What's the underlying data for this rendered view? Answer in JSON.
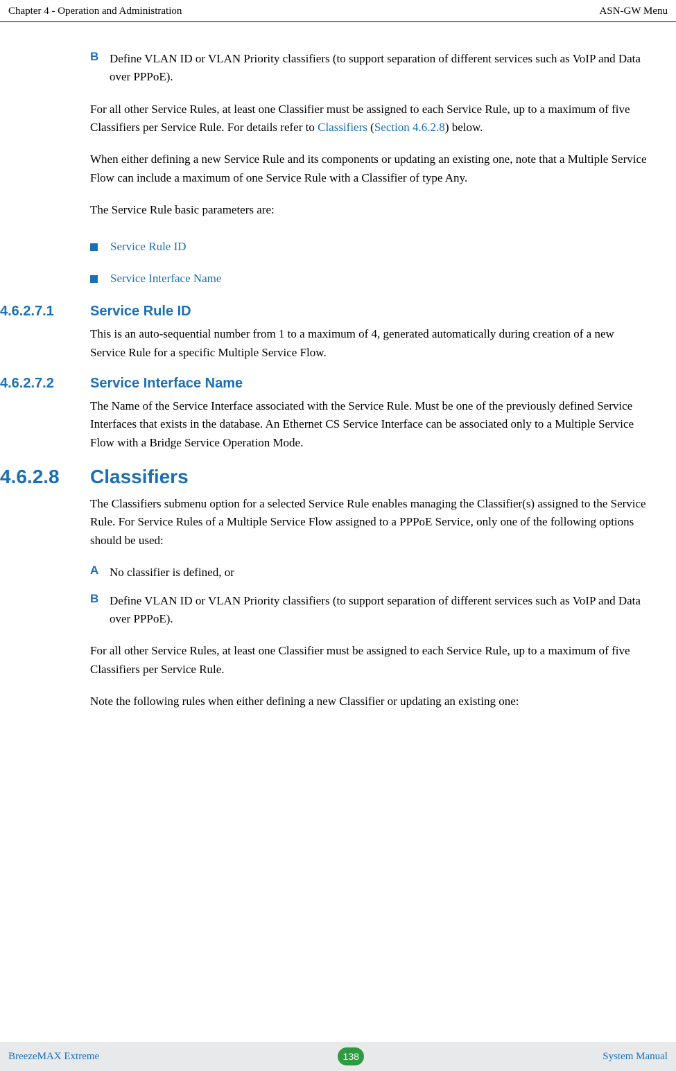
{
  "header": {
    "left": "Chapter 4 - Operation and Administration",
    "right": "ASN-GW Menu"
  },
  "list1": {
    "letter": "B",
    "text": "Define VLAN ID or VLAN Priority classifiers (to support separation of different services such as VoIP and Data over PPPoE)."
  },
  "para1_pre": "For all other Service Rules, at least one Classifier must be assigned to each Service Rule, up to a maximum of five Classifiers per Service Rule. For details refer to ",
  "para1_link1": "Classifiers",
  "para1_mid": " (",
  "para1_link2": "Section 4.6.2.8",
  "para1_post": ") below.",
  "para2": "When either defining a new Service Rule and its components or updating an existing one, note that a Multiple Service Flow can include a maximum of one Service Rule with a Classifier of type Any.",
  "para3": "The Service Rule basic parameters are:",
  "bullet1": "Service Rule ID",
  "bullet2": "Service Interface Name",
  "sec1": {
    "num": "4.6.2.7.1",
    "title": "Service Rule ID",
    "body": "This is an auto-sequential number from 1 to a maximum of 4, generated automatically during creation of a new Service Rule for a specific Multiple Service Flow."
  },
  "sec2": {
    "num": "4.6.2.7.2",
    "title": "Service Interface Name",
    "body": "The Name of the Service Interface associated with the Service Rule. Must be one of the previously defined Service Interfaces that exists in the database. An Ethernet CS Service Interface can be associated only to a Multiple Service Flow with a Bridge Service Operation Mode."
  },
  "sec3": {
    "num": "4.6.2.8",
    "title": "Classifiers",
    "body": "The Classifiers submenu option for a selected Service Rule enables managing the Classifier(s) assigned to the Service Rule. For Service Rules of a Multiple Service Flow assigned to a PPPoE Service, only one of the following options should be used:"
  },
  "list2a": {
    "letter": "A",
    "text": "No classifier is defined, or"
  },
  "list2b": {
    "letter": "B",
    "text": "Define VLAN ID or VLAN Priority classifiers (to support separation of different services such as VoIP and Data over PPPoE)."
  },
  "para4": "For all other Service Rules, at least one Classifier must be assigned to each Service Rule, up to a maximum of five Classifiers per Service Rule.",
  "para5": "Note the following rules when either defining a new Classifier or updating an existing one:",
  "footer": {
    "left": "BreezeMAX Extreme",
    "page": "138",
    "right": "System Manual"
  }
}
